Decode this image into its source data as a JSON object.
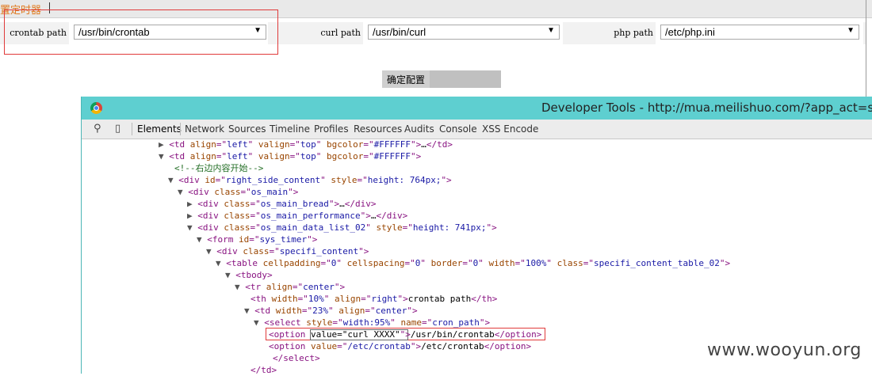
{
  "page": {
    "top_tab_label": "置定时器",
    "fields": [
      {
        "label": "crontab path",
        "value": "/usr/bin/crontab"
      },
      {
        "label": "curl path",
        "value": "/usr/bin/curl"
      },
      {
        "label": "php path",
        "value": "/etc/php.ini"
      }
    ],
    "confirm_label": "确定配置"
  },
  "devtools": {
    "title": "Developer Tools - http://mua.meilishuo.com/?app_act=sy",
    "tabs": [
      "Elements",
      "Network",
      "Sources",
      "Timeline",
      "Profiles",
      "Resources",
      "Audits",
      "Console",
      "XSS Encode"
    ],
    "lines": [
      {
        "tri": "▶",
        "parts": [
          [
            "tag",
            "<td "
          ],
          [
            "attr",
            "align"
          ],
          [
            "tag",
            "=\""
          ],
          [
            "val",
            "left"
          ],
          [
            "tag",
            "\" "
          ],
          [
            "attr",
            "valign"
          ],
          [
            "tag",
            "=\""
          ],
          [
            "val",
            "top"
          ],
          [
            "tag",
            "\" "
          ],
          [
            "attr",
            "bgcolor"
          ],
          [
            "tag",
            "=\""
          ],
          [
            "val",
            "#FFFFFF"
          ],
          [
            "tag",
            "\">"
          ],
          [
            "txt",
            "…"
          ],
          [
            "tag",
            "</td>"
          ]
        ]
      },
      {
        "tri": "▼",
        "parts": [
          [
            "tag",
            "<td "
          ],
          [
            "attr",
            "align"
          ],
          [
            "tag",
            "=\""
          ],
          [
            "val",
            "left"
          ],
          [
            "tag",
            "\" "
          ],
          [
            "attr",
            "valign"
          ],
          [
            "tag",
            "=\""
          ],
          [
            "val",
            "top"
          ],
          [
            "tag",
            "\" "
          ],
          [
            "attr",
            "bgcolor"
          ],
          [
            "tag",
            "=\""
          ],
          [
            "val",
            "#FFFFFF"
          ],
          [
            "tag",
            "\">"
          ]
        ]
      },
      {
        "tri": "",
        "parts": [
          [
            "cmt",
            "<!--右边内容开始-->"
          ]
        ]
      },
      {
        "tri": "▼",
        "parts": [
          [
            "tag",
            "<div "
          ],
          [
            "attr",
            "id"
          ],
          [
            "tag",
            "=\""
          ],
          [
            "val",
            "right_side_content"
          ],
          [
            "tag",
            "\" "
          ],
          [
            "attr",
            "style"
          ],
          [
            "tag",
            "=\""
          ],
          [
            "val",
            "height: 764px;"
          ],
          [
            "tag",
            "\">"
          ]
        ]
      },
      {
        "tri": "▼",
        "parts": [
          [
            "tag",
            "<div "
          ],
          [
            "attr",
            "class"
          ],
          [
            "tag",
            "=\""
          ],
          [
            "val",
            "os_main"
          ],
          [
            "tag",
            "\">"
          ]
        ]
      },
      {
        "tri": "▶",
        "parts": [
          [
            "tag",
            "<div "
          ],
          [
            "attr",
            "class"
          ],
          [
            "tag",
            "=\""
          ],
          [
            "val",
            "os_main_bread"
          ],
          [
            "tag",
            "\">"
          ],
          [
            "txt",
            "…"
          ],
          [
            "tag",
            "</div>"
          ]
        ]
      },
      {
        "tri": "▶",
        "parts": [
          [
            "tag",
            "<div "
          ],
          [
            "attr",
            "class"
          ],
          [
            "tag",
            "=\""
          ],
          [
            "val",
            "os_main_performance"
          ],
          [
            "tag",
            "\">"
          ],
          [
            "txt",
            "…"
          ],
          [
            "tag",
            "</div>"
          ]
        ]
      },
      {
        "tri": "▼",
        "parts": [
          [
            "tag",
            "<div "
          ],
          [
            "attr",
            "class"
          ],
          [
            "tag",
            "=\""
          ],
          [
            "val",
            "os_main_data_list_02"
          ],
          [
            "tag",
            "\" "
          ],
          [
            "attr",
            "style"
          ],
          [
            "tag",
            "=\""
          ],
          [
            "val",
            "height: 741px;"
          ],
          [
            "tag",
            "\">"
          ]
        ]
      },
      {
        "tri": "▼",
        "parts": [
          [
            "tag",
            "<form "
          ],
          [
            "attr",
            "id"
          ],
          [
            "tag",
            "=\""
          ],
          [
            "val",
            "sys_timer"
          ],
          [
            "tag",
            "\">"
          ]
        ]
      },
      {
        "tri": "▼",
        "parts": [
          [
            "tag",
            "<div "
          ],
          [
            "attr",
            "class"
          ],
          [
            "tag",
            "=\""
          ],
          [
            "val",
            "specifi_content"
          ],
          [
            "tag",
            "\">"
          ]
        ]
      },
      {
        "tri": "▼",
        "parts": [
          [
            "tag",
            "<table "
          ],
          [
            "attr",
            "cellpadding"
          ],
          [
            "tag",
            "=\""
          ],
          [
            "val",
            "0"
          ],
          [
            "tag",
            "\" "
          ],
          [
            "attr",
            "cellspacing"
          ],
          [
            "tag",
            "=\""
          ],
          [
            "val",
            "0"
          ],
          [
            "tag",
            "\" "
          ],
          [
            "attr",
            "border"
          ],
          [
            "tag",
            "=\""
          ],
          [
            "val",
            "0"
          ],
          [
            "tag",
            "\" "
          ],
          [
            "attr",
            "width"
          ],
          [
            "tag",
            "=\""
          ],
          [
            "val",
            "100%"
          ],
          [
            "tag",
            "\" "
          ],
          [
            "attr",
            "class"
          ],
          [
            "tag",
            "=\""
          ],
          [
            "val",
            "specifi_content_table_02"
          ],
          [
            "tag",
            "\">"
          ]
        ]
      },
      {
        "tri": "▼",
        "parts": [
          [
            "tag",
            "<tbody>"
          ]
        ]
      },
      {
        "tri": "▼",
        "parts": [
          [
            "tag",
            "<tr "
          ],
          [
            "attr",
            "align"
          ],
          [
            "tag",
            "=\""
          ],
          [
            "val",
            "center"
          ],
          [
            "tag",
            "\">"
          ]
        ]
      },
      {
        "tri": "",
        "parts": [
          [
            "tag",
            "<th "
          ],
          [
            "attr",
            "width"
          ],
          [
            "tag",
            "=\""
          ],
          [
            "val",
            "10%"
          ],
          [
            "tag",
            "\" "
          ],
          [
            "attr",
            "align"
          ],
          [
            "tag",
            "=\""
          ],
          [
            "val",
            "right"
          ],
          [
            "tag",
            "\">"
          ],
          [
            "txt",
            "crontab path"
          ],
          [
            "tag",
            "</th>"
          ]
        ]
      },
      {
        "tri": "▼",
        "parts": [
          [
            "tag",
            "<td "
          ],
          [
            "attr",
            "width"
          ],
          [
            "tag",
            "=\""
          ],
          [
            "val",
            "23%"
          ],
          [
            "tag",
            "\" "
          ],
          [
            "attr",
            "align"
          ],
          [
            "tag",
            "=\""
          ],
          [
            "val",
            "center"
          ],
          [
            "tag",
            "\">"
          ]
        ]
      },
      {
        "tri": "▼",
        "parts": [
          [
            "tag",
            "<select "
          ],
          [
            "attr",
            "style"
          ],
          [
            "tag",
            "=\""
          ],
          [
            "val",
            "width:95%"
          ],
          [
            "tag",
            "\" "
          ],
          [
            "attr",
            "name"
          ],
          [
            "tag",
            "=\""
          ],
          [
            "val",
            "cron_path"
          ],
          [
            "tag",
            "\">"
          ]
        ]
      },
      {
        "tri": "",
        "parts": [
          [
            "tag",
            "<option "
          ],
          [
            "txt",
            "value=\"curl XXXX\""
          ],
          [
            "tag",
            "\">"
          ],
          [
            "txt",
            "/usr/bin/crontab"
          ],
          [
            "tag",
            "</option>"
          ]
        ]
      },
      {
        "tri": "",
        "parts": [
          [
            "tag",
            "<option "
          ],
          [
            "attr",
            "value"
          ],
          [
            "tag",
            "=\""
          ],
          [
            "val",
            "/etc/crontab"
          ],
          [
            "tag",
            "\">"
          ],
          [
            "txt",
            "/etc/crontab"
          ],
          [
            "tag",
            "</option>"
          ]
        ]
      },
      {
        "tri": "",
        "parts": [
          [
            "tag",
            "</select>"
          ]
        ]
      },
      {
        "tri": "",
        "parts": [
          [
            "tag",
            "</td>"
          ]
        ]
      }
    ]
  },
  "watermark": "www.wooyun.org"
}
